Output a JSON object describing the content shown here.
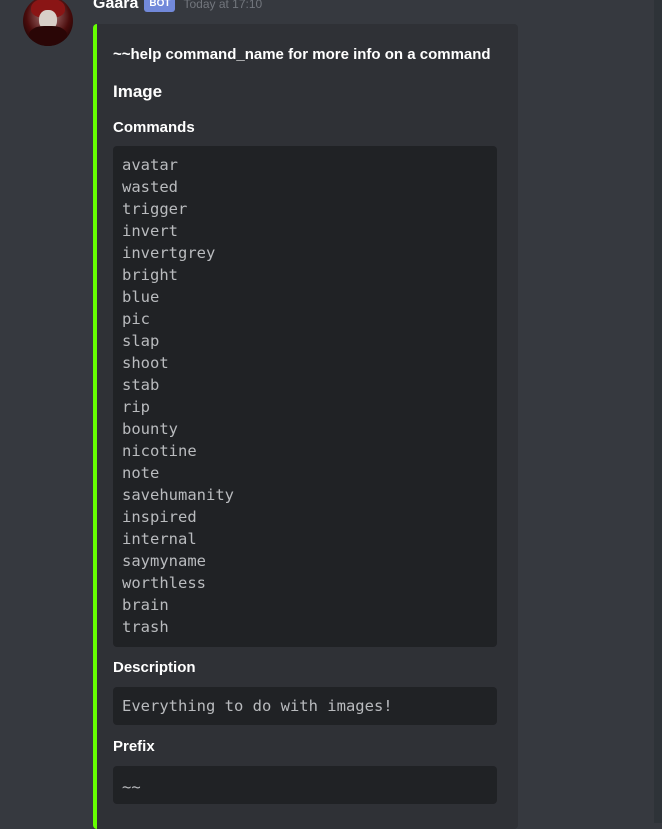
{
  "message": {
    "username": "Gaara",
    "bot_tag": "BOT",
    "timestamp": "Today at 17:10",
    "avatar_icon": "user-avatar-icon"
  },
  "embed": {
    "accent_color": "#66ff00",
    "description": "~~help command_name for more info on a command",
    "category_title": "Image",
    "fields": {
      "commands_title": "Commands",
      "commands": [
        "avatar",
        "wasted",
        "trigger",
        "invert",
        "invertgrey",
        "bright",
        "blue",
        "pic",
        "slap",
        "shoot",
        "stab",
        "rip",
        "bounty",
        "nicotine",
        "note",
        "savehumanity",
        "inspired",
        "internal",
        "saymyname",
        "worthless",
        "brain",
        "trash"
      ],
      "description_title": "Description",
      "description_value": "Everything to do with images!",
      "prefix_title": "Prefix",
      "prefix_value": "~~"
    }
  },
  "colors": {
    "background": "#36393f",
    "embed_background": "#2f3136",
    "code_background": "#202225",
    "bot_tag": "#7289da"
  }
}
